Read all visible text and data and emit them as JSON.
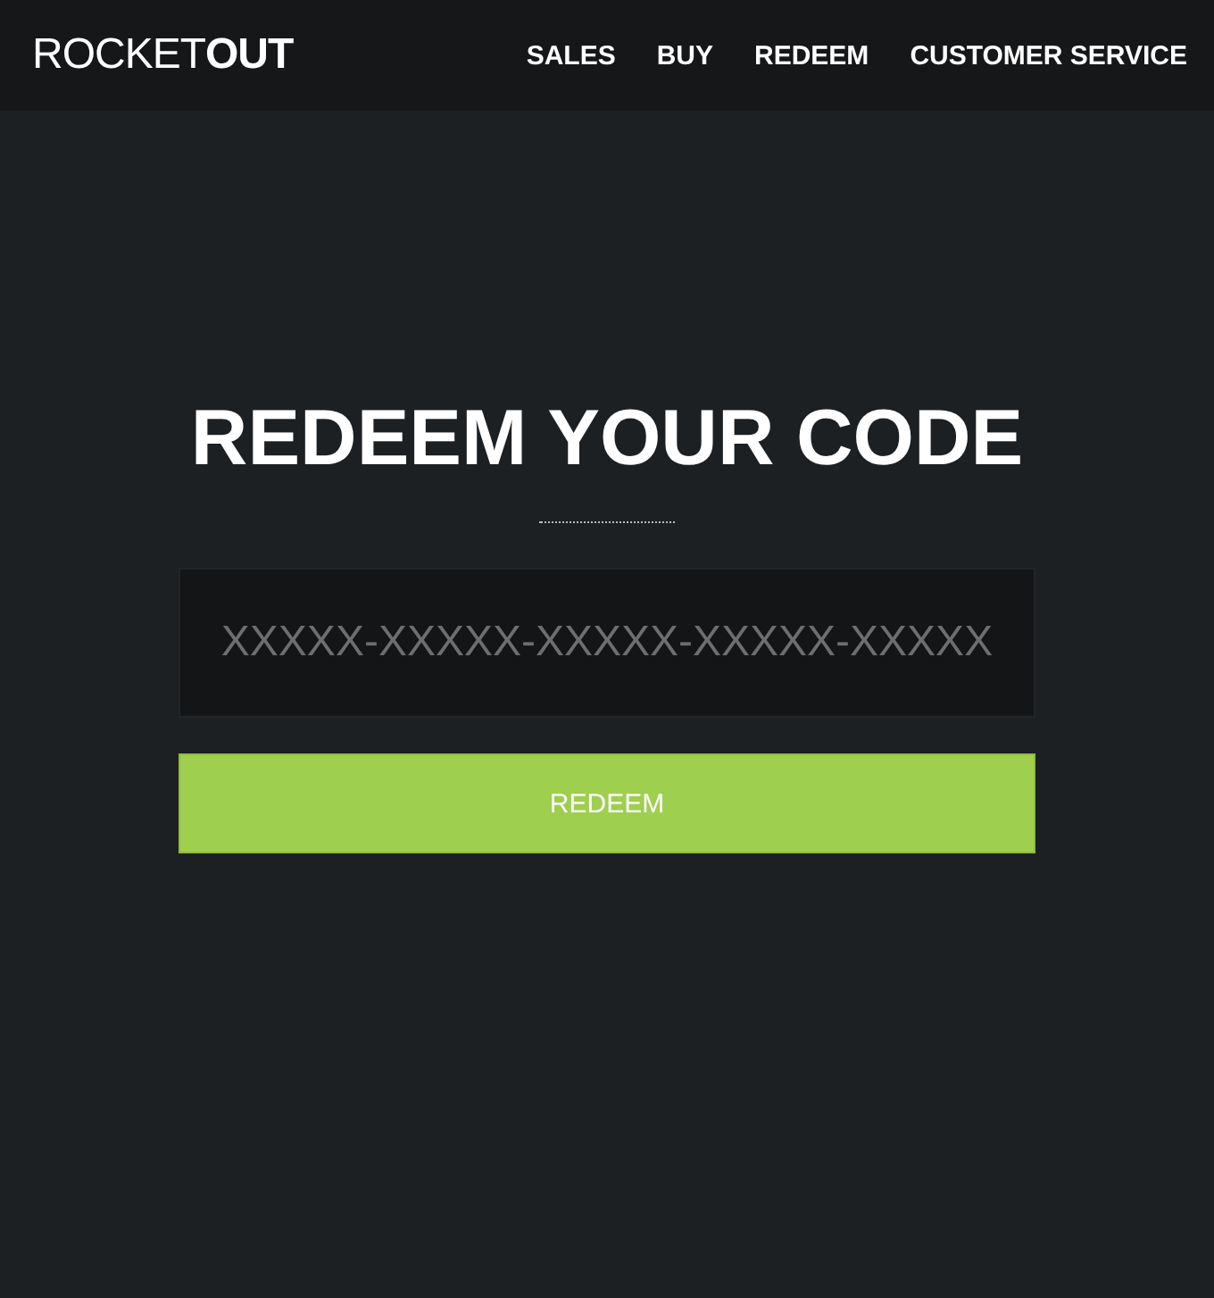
{
  "header": {
    "logo": "ROCKET**OUT**",
    "nav": [
      {
        "label": "SALES"
      },
      {
        "label": "BUY"
      },
      {
        "label": "REDEEM"
      },
      {
        "label": "CUSTOMER SERVICE"
      }
    ]
  },
  "main": {
    "title": "REDEEM YOUR CODE",
    "code_field": {
      "placeholder": "XXXXX-XXXXX-XXXXX-XXXXX-XXXXX"
    },
    "button": "REDEEM"
  }
}
